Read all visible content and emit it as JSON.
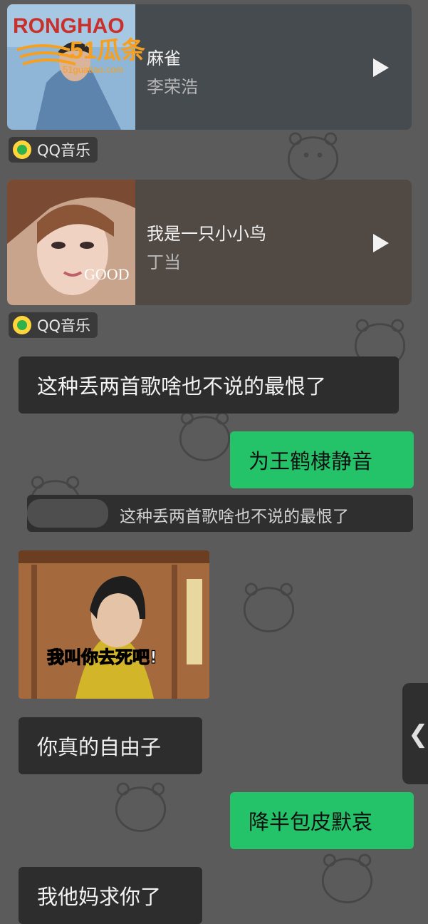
{
  "songs": [
    {
      "title": "麻雀",
      "artist": "李荣浩",
      "source": "QQ音乐",
      "cover_text": "RONGHAO"
    },
    {
      "title": "我是一只小小鸟",
      "artist": "丁当",
      "source": "QQ音乐",
      "cover_text": "GOOD"
    }
  ],
  "messages": {
    "m1": "这种丢两首歌啥也不说的最恨了",
    "m2": "为王鹤棣静音",
    "quote_text": "这种丢两首歌啥也不说的最恨了",
    "sticker_caption": "我叫你去死吧!",
    "m3": "你真的自由子",
    "m4": "降半包皮默哀",
    "m5": "我他妈求你了"
  },
  "watermark": {
    "brand": "51瓜条",
    "url": "51guatiao.com"
  },
  "side_handle": {
    "icon": "chevron-left-icon"
  },
  "colors": {
    "background": "#5b5b5b",
    "bubble_left": "#2d2d2d",
    "bubble_right": "#24c36a"
  }
}
